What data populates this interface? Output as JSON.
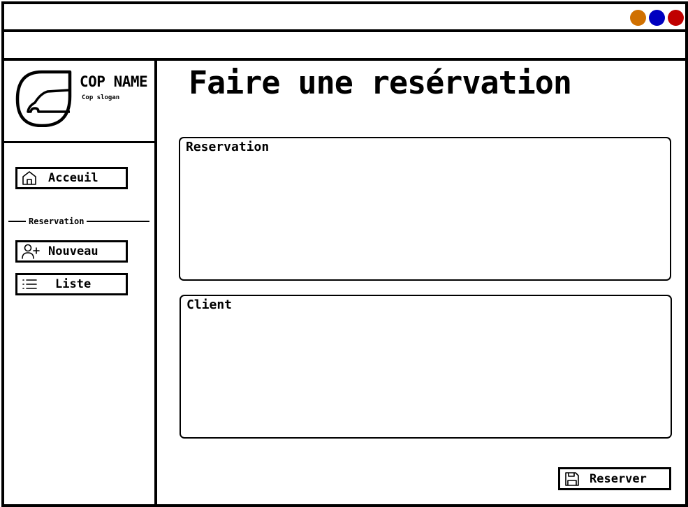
{
  "window": {
    "controls": [
      {
        "name": "minimize",
        "color": "#d07000"
      },
      {
        "name": "maximize",
        "color": "#0000c0"
      },
      {
        "name": "close",
        "color": "#c00000"
      }
    ]
  },
  "brand": {
    "company_name": "COP NAME",
    "slogan": "Cop slogan",
    "logo_icon": "leaf-car-logo"
  },
  "sidebar": {
    "home": {
      "label": "Acceuil",
      "icon": "home-icon"
    },
    "section_label": "Reservation",
    "new": {
      "label": "Nouveau",
      "icon": "user-plus-icon"
    },
    "list": {
      "label": "Liste",
      "icon": "list-icon"
    }
  },
  "main": {
    "title": "Faire une resérvation",
    "reservation_panel": {
      "title": "Reservation"
    },
    "client_panel": {
      "title": "Client"
    },
    "submit": {
      "label": "Reserver",
      "icon": "save-icon"
    }
  }
}
